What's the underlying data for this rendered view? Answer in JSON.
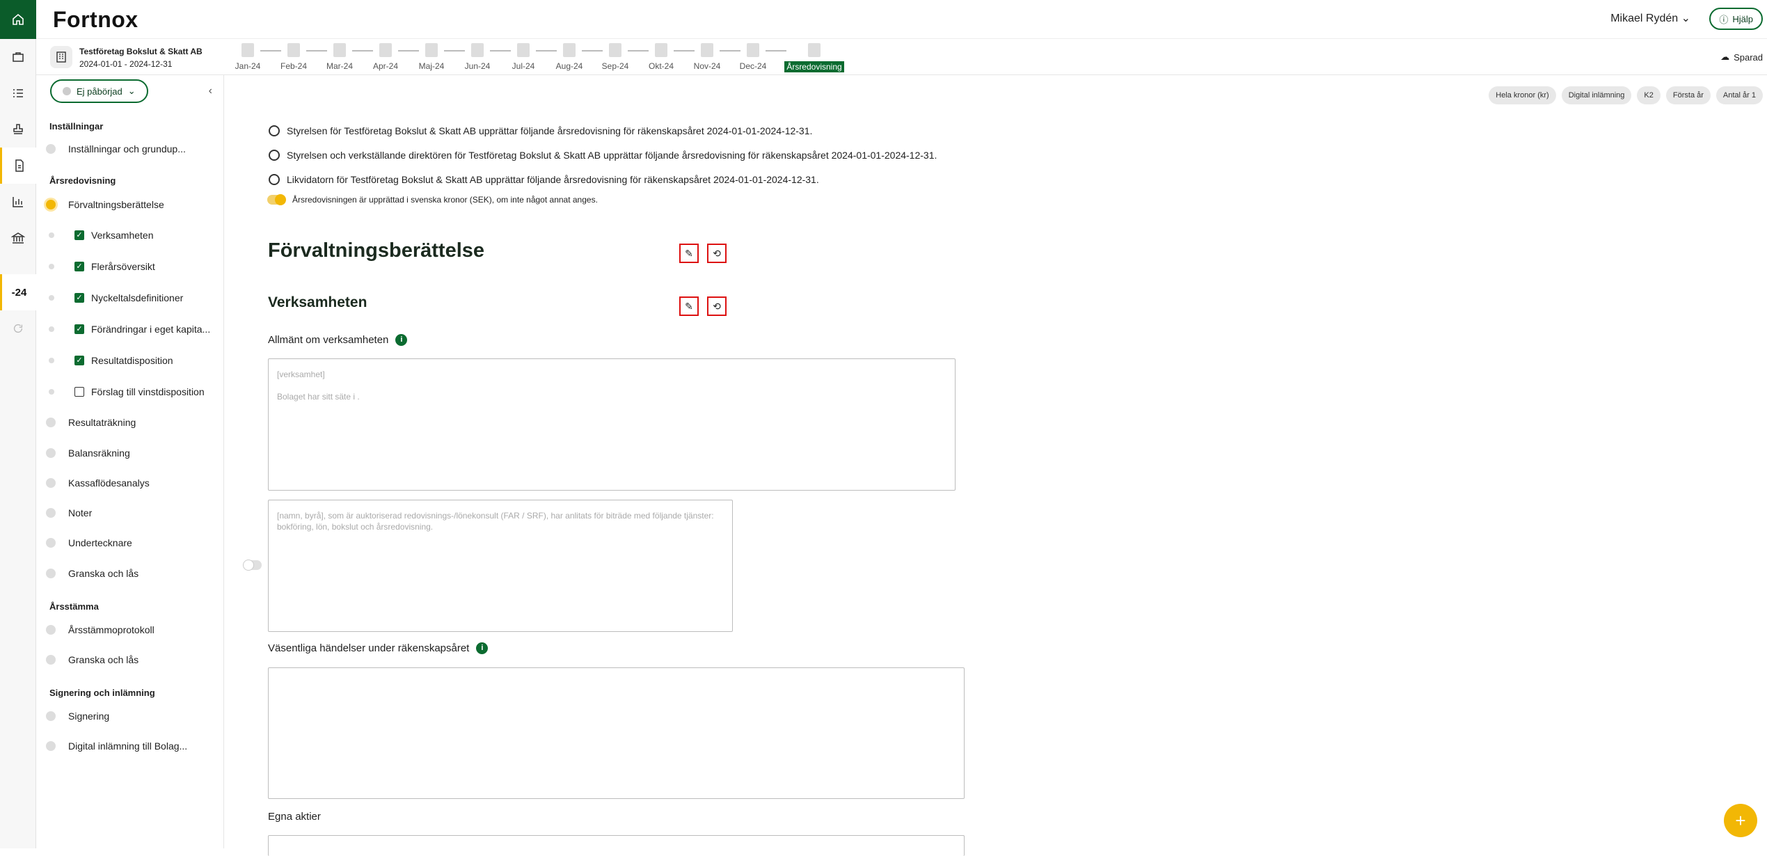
{
  "app": {
    "logo": "Fortnox",
    "user": "Mikael Rydén",
    "help": "Hjälp",
    "saved": "Sparad",
    "rail_year": "-24"
  },
  "company": {
    "name": "Testföretag Bokslut & Skatt AB",
    "period": "2024-01-01 - 2024-12-31"
  },
  "months": [
    "Jan-24",
    "Feb-24",
    "Mar-24",
    "Apr-24",
    "Maj-24",
    "Jun-24",
    "Jul-24",
    "Aug-24",
    "Sep-24",
    "Okt-24",
    "Nov-24",
    "Dec-24",
    "Årsredovisning"
  ],
  "sidebar": {
    "status": "Ej påbörjad",
    "sections": {
      "installningar": "Inställningar",
      "arsredovisning": "Årsredovisning",
      "arsstamma": "Årsstämma",
      "signering": "Signering och inlämning"
    },
    "items": {
      "installningar_item": "Inställningar och grundup...",
      "forvaltning": "Förvaltningsberättelse",
      "verksamheten": "Verksamheten",
      "flerars": "Flerårsöversikt",
      "nyckeltal": "Nyckeltalsdefinitioner",
      "forandringar": "Förändringar i eget kapita...",
      "resultatdisp": "Resultatdisposition",
      "forslag": "Förslag till vinstdisposition",
      "resultatrakning": "Resultaträkning",
      "balansrakning": "Balansräkning",
      "kassaflode": "Kassaflödesanalys",
      "noter": "Noter",
      "underteckn": "Undertecknare",
      "granska1": "Granska och lås",
      "stammoprotokoll": "Årsstämmoprotokoll",
      "granska2": "Granska och lås",
      "signering_item": "Signering",
      "digital": "Digital inlämning till Bolag..."
    }
  },
  "tags": [
    "Hela kronor (kr)",
    "Digital inlämning",
    "K2",
    "Första år",
    "Antal år 1"
  ],
  "radios": [
    "Styrelsen för Testföretag Bokslut & Skatt AB upprättar följande årsredovisning för räkenskapsåret 2024-01-01-2024-12-31.",
    "Styrelsen och verkställande direktören för Testföretag Bokslut & Skatt AB upprättar följande årsredovisning för räkenskapsåret 2024-01-01-2024-12-31.",
    "Likvidatorn för Testföretag Bokslut & Skatt AB upprättar följande årsredovisning för räkenskapsåret 2024-01-01-2024-12-31."
  ],
  "currency_toggle": "Årsredovisningen är upprättad i svenska kronor (SEK), om inte något annat anges.",
  "heading1": "Förvaltningsberättelse",
  "heading2": "Verksamheten",
  "field1": {
    "label": "Allmänt om verksamheten",
    "line1": "[verksamhet]",
    "line2": "Bolaget har sitt säte i ."
  },
  "field2": {
    "text": "[namn, byrå], som är auktoriserad redovisnings-/lönekonsult (FAR / SRF), har anlitats för biträde med följande tjänster: bokföring, lön, bokslut och årsredovisning."
  },
  "field3": {
    "label": "Väsentliga händelser under räkenskapsåret"
  },
  "field4": {
    "label": "Egna aktier"
  },
  "colors": {
    "brand": "#0b6b30",
    "accent": "#f2b705"
  }
}
